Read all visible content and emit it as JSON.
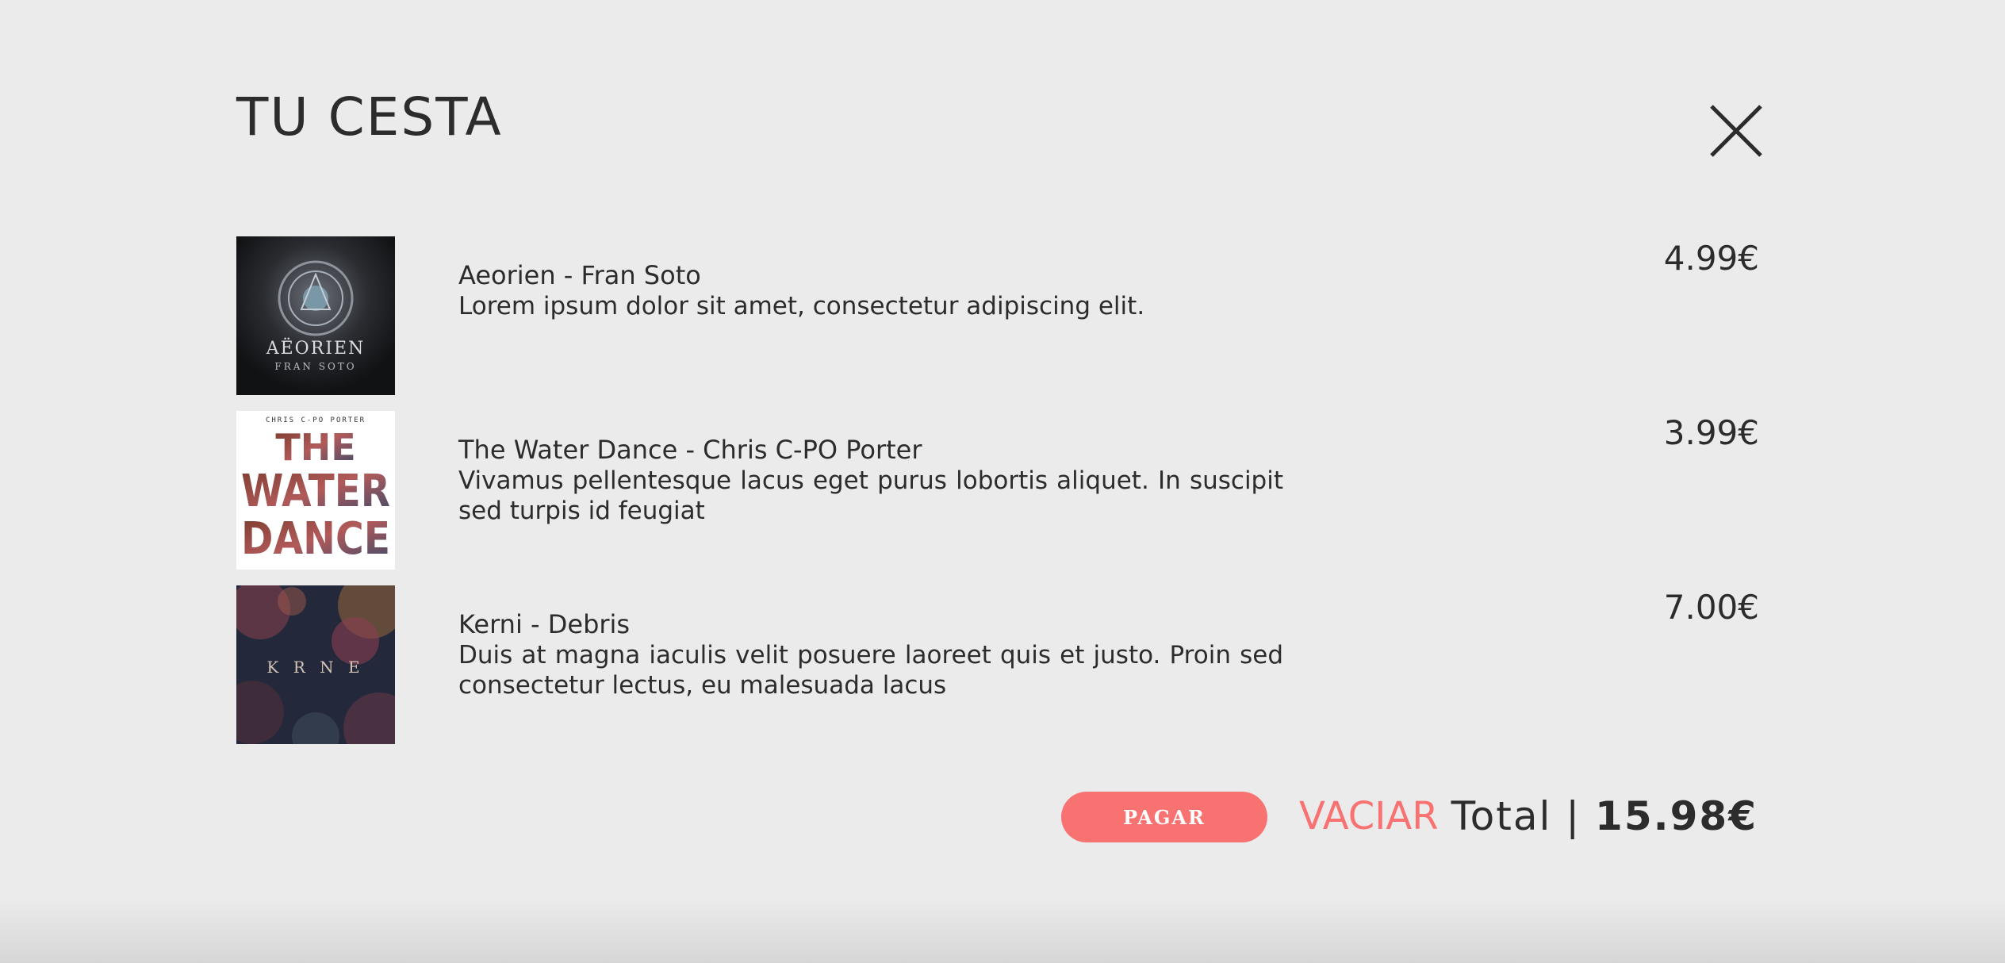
{
  "cart": {
    "title": "TU CESTA",
    "items": [
      {
        "name": "Aeorien - Fran Soto",
        "description": "Lorem ipsum dolor sit amet, consectetur adipiscing elit.",
        "price": "4.99€",
        "cover_text": [
          "AËORIEN",
          "FRAN SOTO"
        ]
      },
      {
        "name": "The Water Dance - Chris C-PO Porter",
        "description": "Vivamus pellentesque lacus eget purus lobortis aliquet. In suscipit sed turpis id feugiat",
        "price": "3.99€",
        "cover_text": [
          "CHRIS C-PO PORTER",
          "THE",
          "WATER",
          "DANCE"
        ]
      },
      {
        "name": "Kerni - Debris",
        "description": "Duis at magna iaculis velit posuere laoreet quis et justo. Proin sed consectetur lectus, eu malesuada lacus",
        "price": "7.00€",
        "cover_text": [
          "K R N E"
        ]
      }
    ],
    "pay_label": "PAGAR",
    "empty_label": "VACIAR",
    "total_label": "Total | ",
    "total_value": "15.98€"
  },
  "colors": {
    "background": "#ebebeb",
    "text": "#2c2c2c",
    "accent": "#f87272"
  },
  "icons": {
    "close": "close-icon"
  }
}
